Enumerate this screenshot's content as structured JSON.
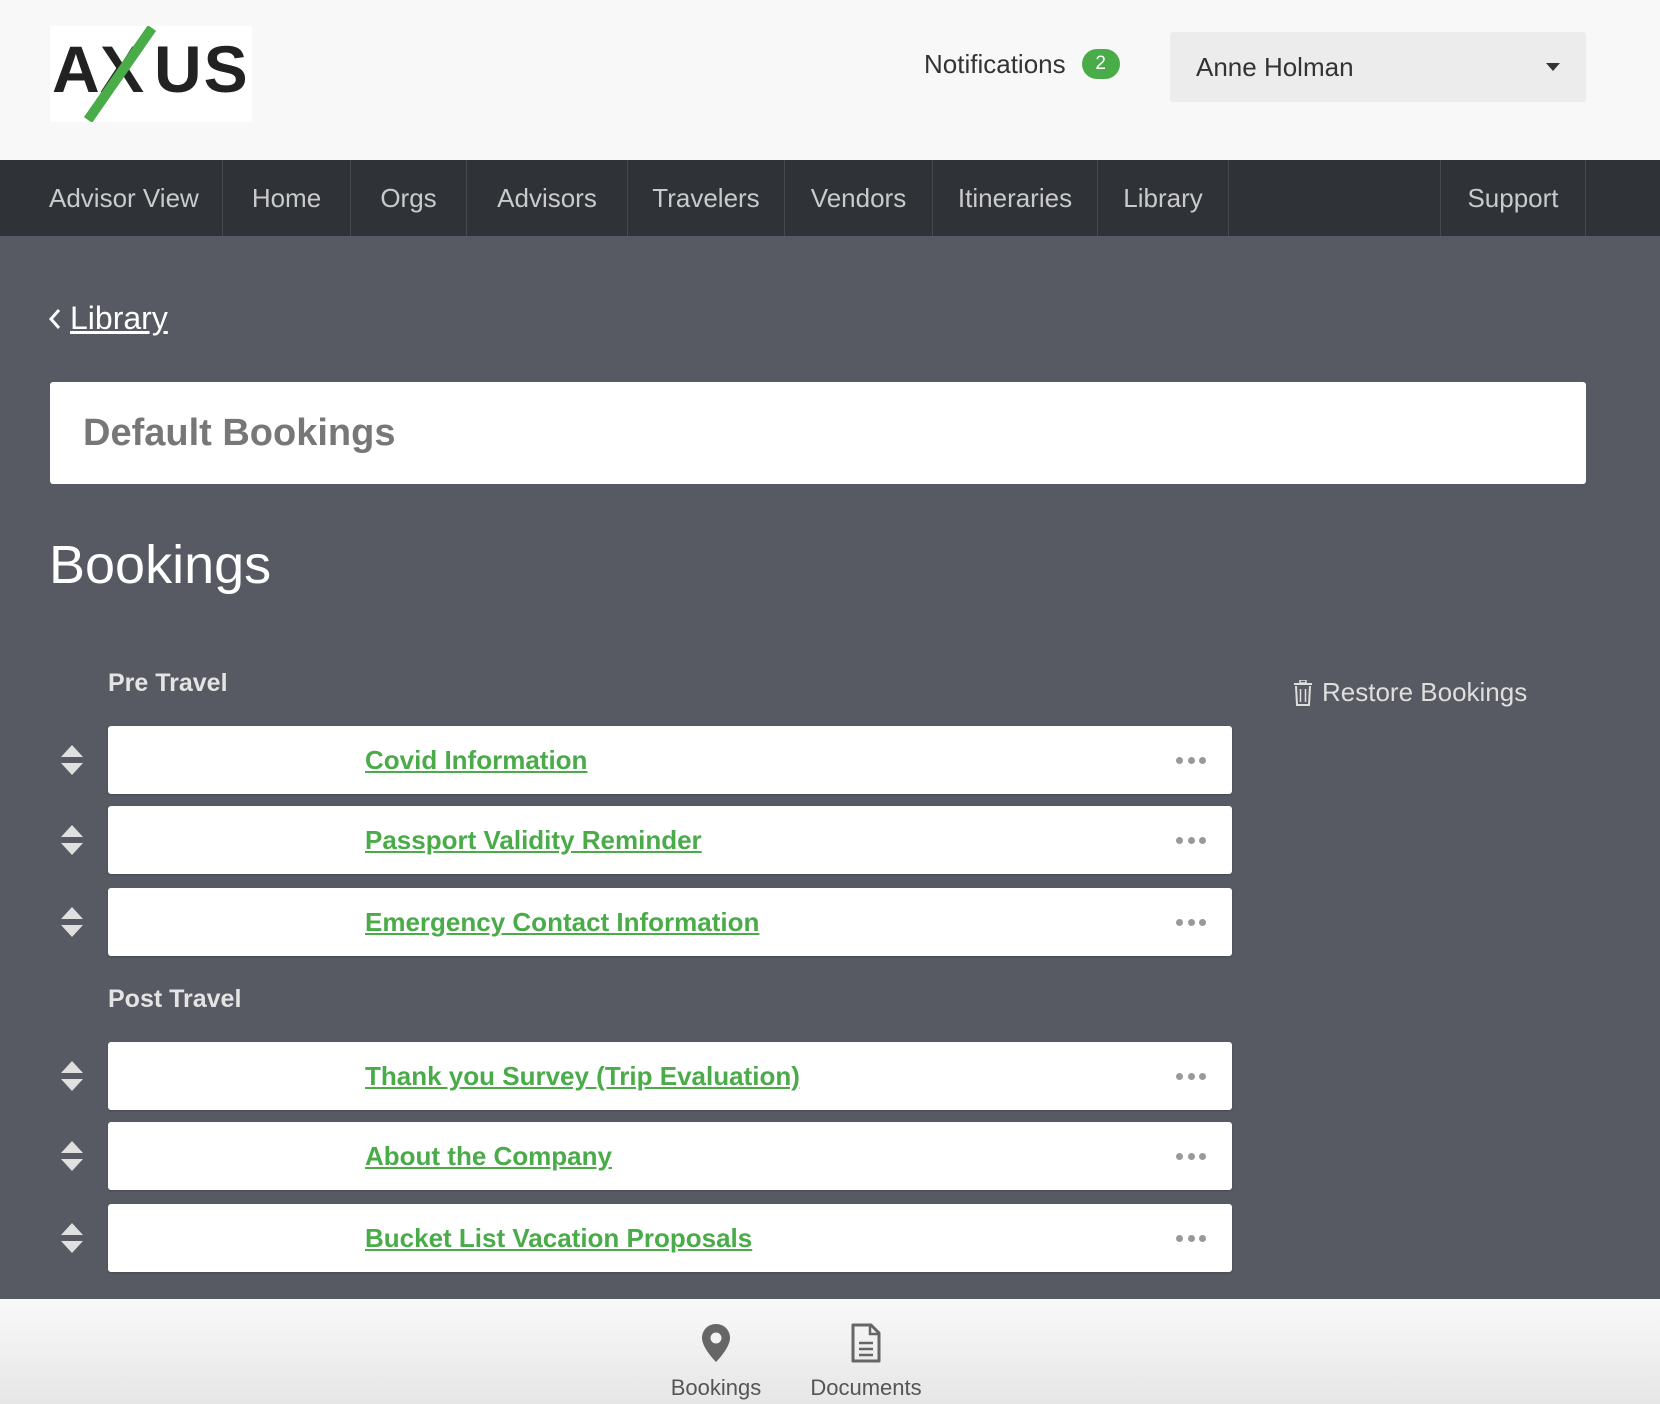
{
  "header": {
    "logo_text": "AXUS",
    "notifications_label": "Notifications",
    "notifications_count": "2",
    "user_name": "Anne Holman"
  },
  "nav": {
    "items": [
      {
        "label": "Advisor View"
      },
      {
        "label": "Home"
      },
      {
        "label": "Orgs"
      },
      {
        "label": "Advisors"
      },
      {
        "label": "Travelers"
      },
      {
        "label": "Vendors"
      },
      {
        "label": "Itineraries"
      },
      {
        "label": "Library"
      },
      {
        "label": "Support"
      }
    ]
  },
  "breadcrumb": {
    "back_label": "Library"
  },
  "page": {
    "title": "Default Bookings",
    "section_heading": "Bookings",
    "restore_label": "Restore Bookings"
  },
  "groups": [
    {
      "label": "Pre Travel",
      "items": [
        {
          "title": "Covid Information"
        },
        {
          "title": "Passport Validity Reminder"
        },
        {
          "title": "Emergency Contact Information"
        }
      ]
    },
    {
      "label": "Post Travel",
      "items": [
        {
          "title": "Thank you Survey (Trip Evaluation)"
        },
        {
          "title": "About the Company"
        },
        {
          "title": "Bucket List Vacation Proposals"
        }
      ]
    }
  ],
  "bottom_bar": {
    "items": [
      {
        "label": "Bookings",
        "icon": "map-pin-icon"
      },
      {
        "label": "Documents",
        "icon": "document-icon"
      }
    ]
  },
  "colors": {
    "accent_green": "#4aab49",
    "nav_background": "#2f3237",
    "content_background": "#575a63"
  }
}
